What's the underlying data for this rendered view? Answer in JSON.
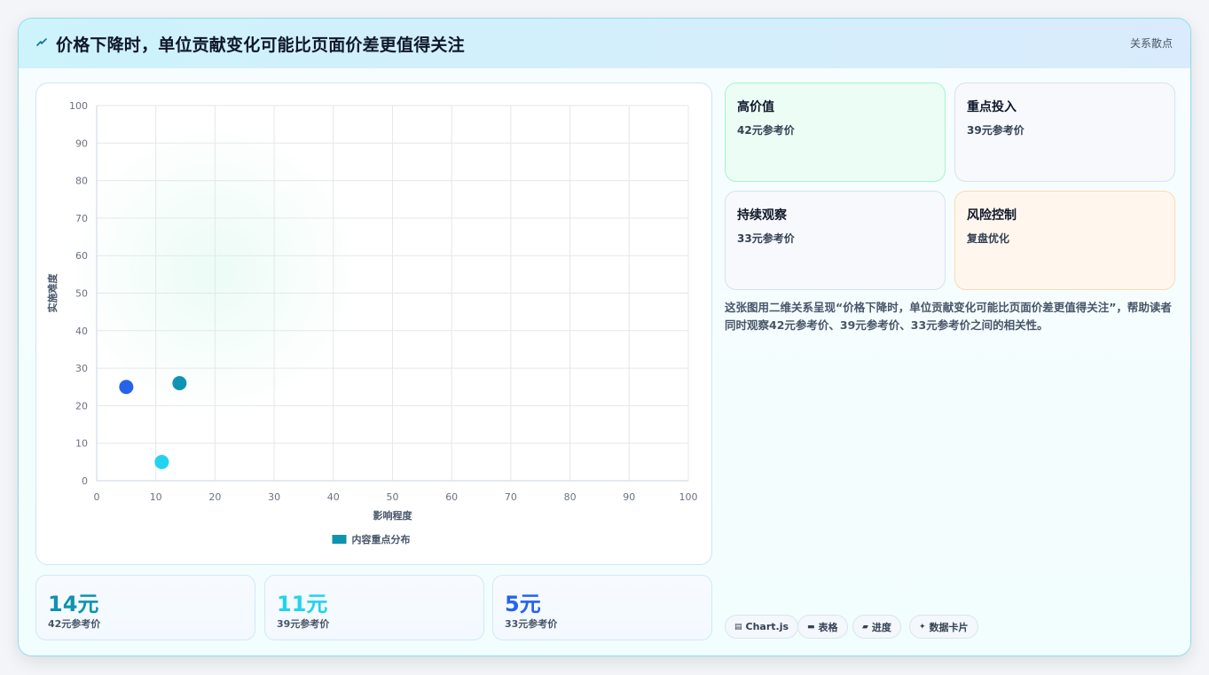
{
  "header": {
    "icon": "lightning-icon",
    "title": "价格下降时，单位贡献变化可能比页面价差更值得关注",
    "badge": "关系散点"
  },
  "chart_data": {
    "type": "scatter",
    "xlabel": "影响程度",
    "ylabel": "实施难度",
    "xlim": [
      0,
      100
    ],
    "ylim": [
      0,
      100
    ],
    "xticks": [
      "0",
      "10",
      "20",
      "30",
      "40",
      "50",
      "60",
      "70",
      "80",
      "90",
      "100"
    ],
    "yticks": [
      "0",
      "10",
      "20",
      "30",
      "40",
      "50",
      "60",
      "70",
      "80",
      "90",
      "100"
    ],
    "grid": true,
    "legend": {
      "position": "bottom",
      "label": "内容重点分布",
      "color": "#0e93b0"
    },
    "series": [
      {
        "name": "内容重点分布",
        "points": [
          {
            "x": 5,
            "y": 25,
            "color": "#2563eb"
          },
          {
            "x": 14,
            "y": 26,
            "color": "#0e93b0"
          },
          {
            "x": 11,
            "y": 5,
            "color": "#22d3ee"
          }
        ]
      }
    ]
  },
  "stats": [
    {
      "value": "14元",
      "label": "42元参考价",
      "color": "#0e93b0"
    },
    {
      "value": "11元",
      "label": "39元参考价",
      "color": "#22d3ee"
    },
    {
      "value": "5元",
      "label": "33元参考价",
      "color": "#2563eb"
    }
  ],
  "tiles": [
    {
      "title": "高价值",
      "sub": "42元参考价",
      "bg": "#ecfdf5",
      "border": "#a7f3d0"
    },
    {
      "title": "重点投入",
      "sub": "39元参考价",
      "bg": "#f7f9fc",
      "border": "#d5e3ee"
    },
    {
      "title": "持续观察",
      "sub": "33元参考价",
      "bg": "#f7f9fc",
      "border": "#d5e3ee"
    },
    {
      "title": "风险控制",
      "sub": "复盘优化",
      "bg": "#fff7ed",
      "border": "#fcd9b0"
    }
  ],
  "description": "这张图用二维关系呈现“价格下降时，单位贡献变化可能比页面价差更值得关注”，帮助读者同时观察42元参考价、39元参考价、33元参考价之间的相关性。",
  "tags": [
    {
      "icon": "chart-icon",
      "label": "Chart.js"
    },
    {
      "icon": "table-icon",
      "label": "表格"
    },
    {
      "icon": "progress-icon",
      "label": "进度"
    },
    {
      "icon": "sparkle-icon",
      "label": "数据卡片"
    }
  ]
}
